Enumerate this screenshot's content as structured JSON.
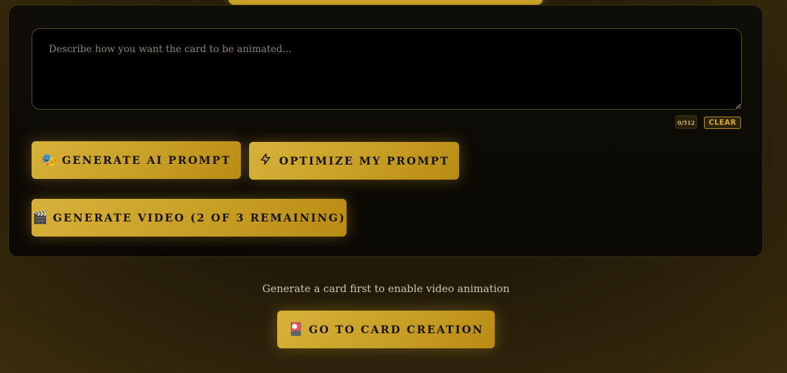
{
  "prompt": {
    "placeholder": "Describe how you want the card to be animated...",
    "value": ""
  },
  "counter": {
    "text": "0/512"
  },
  "clear_label": "CLEAR",
  "buttons": {
    "generate_ai_prompt": {
      "label": "Generate AI Prompt",
      "icon": "theater-masks-icon",
      "glyph": "🎭"
    },
    "optimize_prompt": {
      "label": "Optimize My Prompt",
      "icon": "lightning-icon",
      "glyph": "⚡"
    },
    "generate_video": {
      "label": "Generate Video (2 of 3 remaining)",
      "icon": "clapperboard-icon",
      "glyph": "🎬"
    },
    "go_to_card_creation": {
      "label": "Go to Card Creation",
      "icon": "card-icon",
      "glyph": "🎴"
    }
  },
  "hint": "Generate a card first to enable video animation",
  "colors": {
    "gold_accent": "#c9a227",
    "panel_bg": "#0b0905",
    "page_bg": "#2a200a"
  }
}
